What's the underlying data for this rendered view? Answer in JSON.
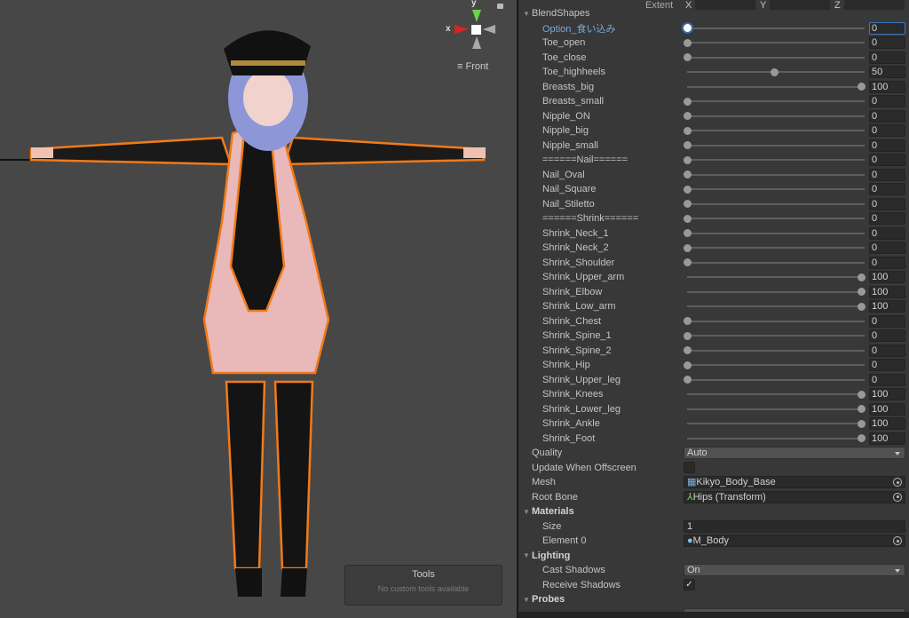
{
  "scene": {
    "gizmo": {
      "x": "x",
      "y": "y",
      "view": "Front"
    },
    "tools": {
      "title": "Tools",
      "message": "No custom tools available"
    }
  },
  "inspector": {
    "extent": {
      "label": "Extent",
      "x_label": "X",
      "y_label": "Y",
      "z_label": "Z"
    },
    "blendshapes_header": "BlendShapes",
    "blendshapes": [
      {
        "name": "Option_食い込み",
        "value": 0,
        "active": true
      },
      {
        "name": "Toe_open",
        "value": 0
      },
      {
        "name": "Toe_close",
        "value": 0
      },
      {
        "name": "Toe_highheels",
        "value": 50
      },
      {
        "name": "Breasts_big",
        "value": 100
      },
      {
        "name": "Breasts_small",
        "value": 0
      },
      {
        "name": "Nipple_ON",
        "value": 0
      },
      {
        "name": "Nipple_big",
        "value": 0
      },
      {
        "name": "Nipple_small",
        "value": 0
      },
      {
        "name": "======Nail======",
        "value": 0
      },
      {
        "name": "Nail_Oval",
        "value": 0
      },
      {
        "name": "Nail_Square",
        "value": 0
      },
      {
        "name": "Nail_Stiletto",
        "value": 0
      },
      {
        "name": "======Shrink======",
        "value": 0
      },
      {
        "name": "Shrink_Neck_1",
        "value": 0
      },
      {
        "name": "Shrink_Neck_2",
        "value": 0
      },
      {
        "name": "Shrink_Shoulder",
        "value": 0
      },
      {
        "name": "Shrink_Upper_arm",
        "value": 100
      },
      {
        "name": "Shrink_Elbow",
        "value": 100
      },
      {
        "name": "Shrink_Low_arm",
        "value": 100
      },
      {
        "name": "Shrink_Chest",
        "value": 0
      },
      {
        "name": "Shrink_Spine_1",
        "value": 0
      },
      {
        "name": "Shrink_Spine_2",
        "value": 0
      },
      {
        "name": "Shrink_Hip",
        "value": 0
      },
      {
        "name": "Shrink_Upper_leg",
        "value": 0
      },
      {
        "name": "Shrink_Knees",
        "value": 100
      },
      {
        "name": "Shrink_Lower_leg",
        "value": 100
      },
      {
        "name": "Shrink_Ankle",
        "value": 100
      },
      {
        "name": "Shrink_Foot",
        "value": 100
      }
    ],
    "quality": {
      "label": "Quality",
      "value": "Auto"
    },
    "update_offscreen": {
      "label": "Update When Offscreen",
      "checked": false
    },
    "mesh": {
      "label": "Mesh",
      "value": "Kikyo_Body_Base",
      "icon": "mesh-icon"
    },
    "root_bone": {
      "label": "Root Bone",
      "value": "Hips (Transform)",
      "icon": "transform-icon"
    },
    "materials": {
      "label": "Materials",
      "size_label": "Size",
      "size": "1",
      "element0_label": "Element 0",
      "element0": "M_Body",
      "icon": "material-icon"
    },
    "lighting": {
      "label": "Lighting",
      "cast_label": "Cast Shadows",
      "cast": "On",
      "receive_label": "Receive Shadows",
      "receive": true
    },
    "probes": {
      "label": "Probes"
    },
    "accent": "#3a79bb",
    "selection_outline": "#f07a1a"
  }
}
